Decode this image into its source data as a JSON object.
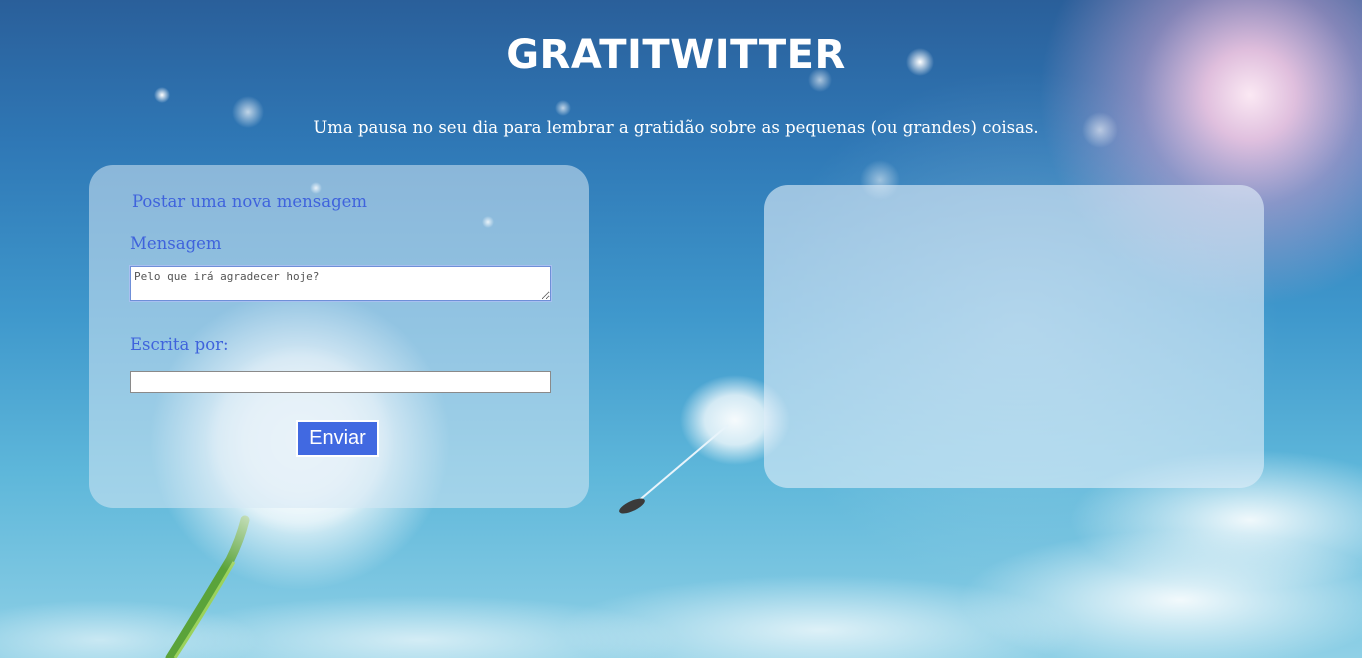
{
  "header": {
    "title": "GRATITWITTER",
    "subtitle": "Uma pausa no seu dia para lembrar a gratidão sobre as pequenas (ou grandes) coisas."
  },
  "form": {
    "heading": "Postar uma nova mensagem",
    "message_label": "Mensagem",
    "message_placeholder": "Pelo que irá agradecer hoje?",
    "message_value": "",
    "author_label": "Escrita por:",
    "author_value": "",
    "submit_label": "Enviar"
  },
  "colors": {
    "accent": "#4169e1",
    "label_text": "#3f63dc",
    "title_text": "#ffffff"
  }
}
